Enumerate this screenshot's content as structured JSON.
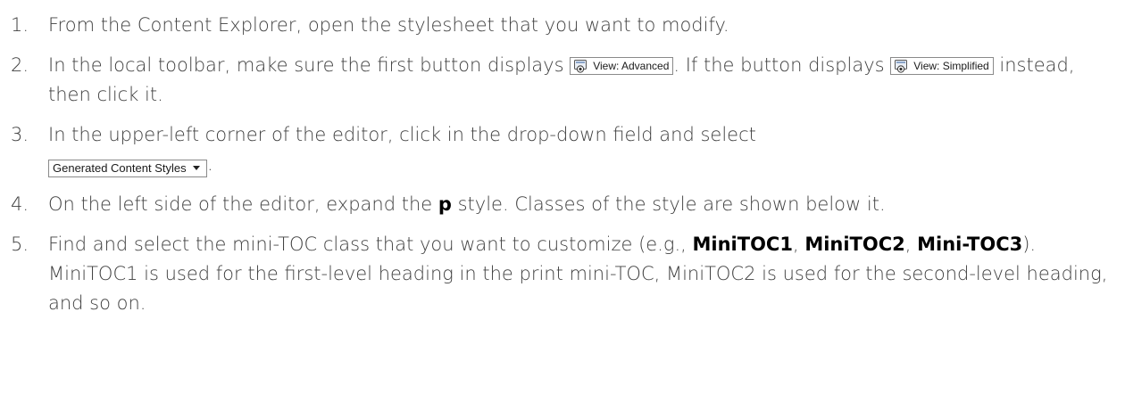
{
  "steps": [
    {
      "number": "1.",
      "text": "From the Content Explorer, open the stylesheet that you want to modify."
    },
    {
      "number": "2.",
      "text_before": "In the local toolbar, make sure the first button displays ",
      "button_advanced": "View: Advanced",
      "text_middle": ". If the button displays ",
      "button_simplified": "View: Simplified",
      "text_after": " instead, then click it."
    },
    {
      "number": "3.",
      "text": "In the upper-left corner of the editor, click in the drop-down field and select",
      "dropdown_value": "Generated Content Styles",
      "text_after": "."
    },
    {
      "number": "4.",
      "text_before": "On the left side of the editor, expand the ",
      "bold": "p",
      "text_after": " style. Classes of the style are shown below it."
    },
    {
      "number": "5.",
      "text_before": "Find and select the mini-TOC class that you want to customize (e.g., ",
      "bold1": "MiniTOC1",
      "sep1": ", ",
      "bold2": "MiniTOC2",
      "sep2": ",",
      "bold3": "Mini-TOC3",
      "text_after": "). MiniTOC1 is used for the first-level heading in the print mini-TOC, MiniTOC2 is used for the second-level heading, and so on."
    }
  ],
  "icons": {
    "view_button_icon": "view-mode-icon",
    "dropdown_arrow": "triangle-down-icon"
  },
  "colors": {
    "text": "#404040",
    "highlight": "#000000",
    "ui_border": "#8a8a8a"
  }
}
